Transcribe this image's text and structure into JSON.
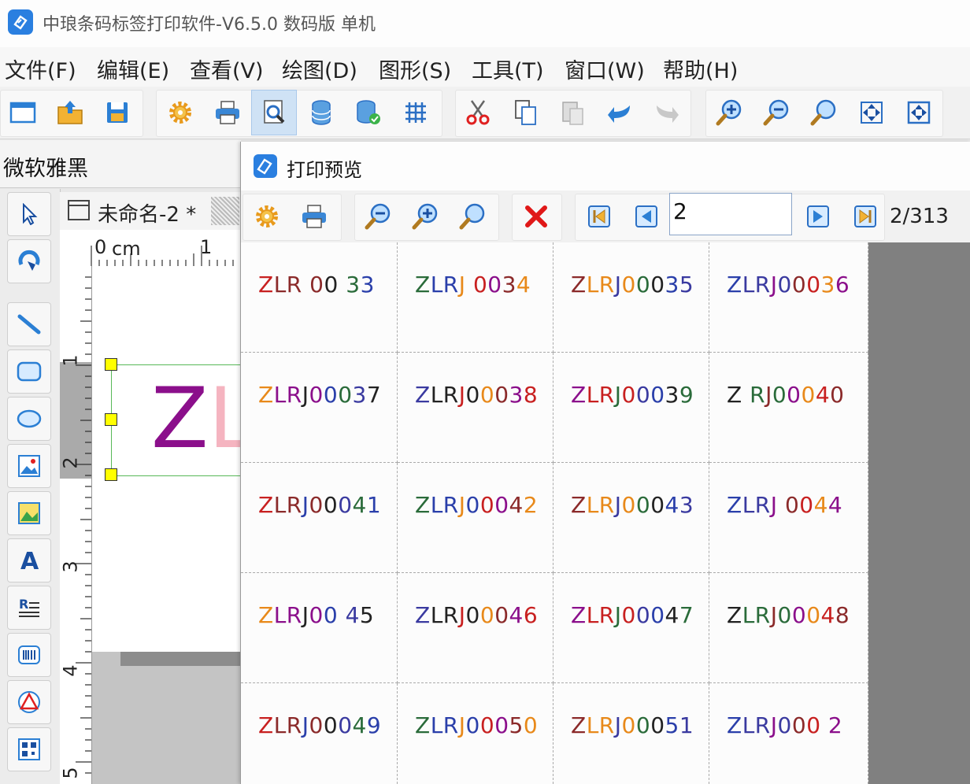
{
  "window": {
    "title": "中琅条码标签打印软件-V6.5.0 数码版 单机"
  },
  "menu": [
    "文件(F)",
    "编辑(E)",
    "查看(V)",
    "绘图(D)",
    "图形(S)",
    "工具(T)",
    "窗口(W)",
    "帮助(H)"
  ],
  "toolbar": {
    "icons": [
      "new-window-icon",
      "open-folder-icon",
      "save-icon",
      "settings-gear-icon",
      "print-icon",
      "print-preview-icon",
      "database-icon",
      "database-connect-icon",
      "grid-icon",
      "cut-icon",
      "copy-icon",
      "paste-icon",
      "undo-icon",
      "redo-icon",
      "zoom-in-icon",
      "zoom-out-icon",
      "zoom-fit-icon",
      "fit-page-icon",
      "fit-width-icon"
    ],
    "active": "print-preview-icon"
  },
  "font_bar": {
    "font_name": "微软雅黑"
  },
  "document": {
    "tab_label": "未命名-2 *",
    "ruler_unit": "cm",
    "ruler_h_labels": [
      "0",
      "1"
    ],
    "ruler_v_labels": [
      "1",
      "2",
      "3",
      "4",
      "5"
    ],
    "label_text": "ZL"
  },
  "preview": {
    "title": "打印预览",
    "current_page": "2",
    "page_count": "2/313",
    "codes": [
      "ZLR 00 33",
      "ZLRJ 0034",
      "ZLRJ00035",
      "ZLRJ00036",
      "ZLRJ00037",
      "ZLRJ00038",
      "ZLRJ00039",
      "Z RJ00040",
      "ZLRJ00041",
      "ZLRJ00042",
      "ZLRJ00043",
      "ZLRJ 0044",
      "ZLRJ00 45",
      "ZLRJ00046",
      "ZLRJ00047",
      "ZLRJ00048",
      "ZLRJ00049",
      "ZLRJ00050",
      "ZLRJ00051",
      "ZLRJ000 2"
    ]
  },
  "colors": {
    "accent": "#2a7fe0",
    "label_purple": "#8b0f8b",
    "label_pink": "#f5b4c0",
    "handle_yellow": "#ffff00",
    "selection_green": "#58b858"
  }
}
